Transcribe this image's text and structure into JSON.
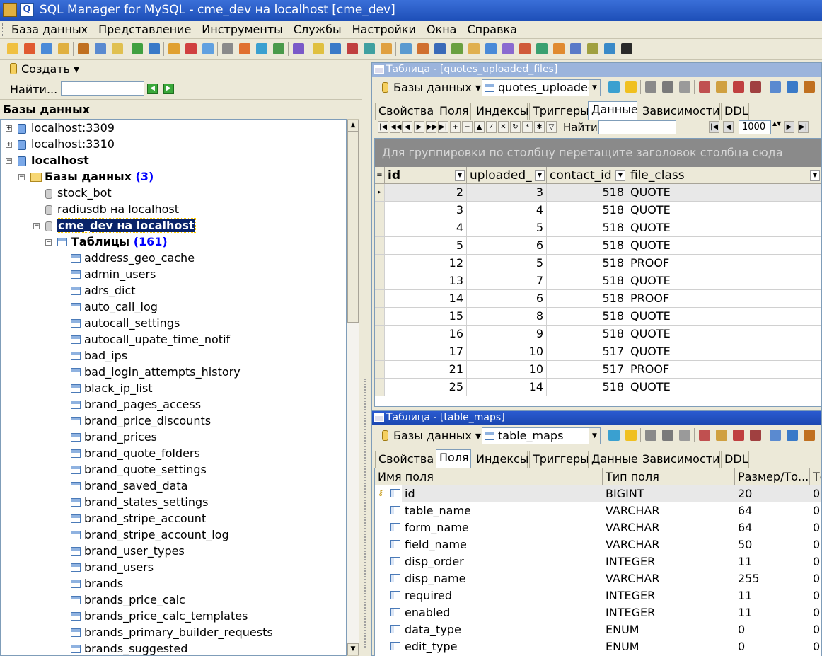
{
  "window": {
    "title": "SQL Manager for MySQL - cme_dev на localhost [cme_dev]"
  },
  "menu": [
    "База данных",
    "Представление",
    "Инструменты",
    "Службы",
    "Настройки",
    "Окна",
    "Справка"
  ],
  "left_panel": {
    "create_label": "Создать",
    "find_label": "Найти...",
    "find_value": "",
    "header": "Базы данных",
    "tree": {
      "servers": [
        "localhost:3309",
        "localhost:3310",
        "localhost"
      ],
      "databases_label": "Базы данных",
      "databases_count": "(3)",
      "databases": [
        "stock_bot",
        "radiusdb на localhost",
        "cme_dev на localhost"
      ],
      "tables_label": "Таблицы",
      "tables_count": "(161)",
      "tables": [
        "address_geo_cache",
        "admin_users",
        "adrs_dict",
        "auto_call_log",
        "autocall_settings",
        "autocall_upate_time_notif",
        "bad_ips",
        "bad_login_attempts_history",
        "black_ip_list",
        "brand_pages_access",
        "brand_price_discounts",
        "brand_prices",
        "brand_quote_folders",
        "brand_quote_settings",
        "brand_saved_data",
        "brand_states_settings",
        "brand_stripe_account",
        "brand_stripe_account_log",
        "brand_user_types",
        "brand_users",
        "brands",
        "brands_price_calc",
        "brands_price_calc_templates",
        "brands_primary_builder_requests",
        "brands_suggested"
      ]
    }
  },
  "window1": {
    "title": "Таблица - [quotes_uploaded_files]",
    "db_button": "Базы данных",
    "table_combo": "quotes_uploaded_files",
    "tabs": [
      "Свойства",
      "Поля",
      "Индексы",
      "Триггеры",
      "Данные",
      "Зависимости",
      "DDL"
    ],
    "active_tab": "Данные",
    "find_label": "Найти:",
    "limit": "1000",
    "group_hint": "Для группировки по столбцу перетащите заголовок столбца сюда",
    "columns": [
      "id",
      "uploaded_",
      "contact_id",
      "file_class"
    ],
    "rows": [
      [
        "2",
        "3",
        "518",
        "QUOTE"
      ],
      [
        "3",
        "4",
        "518",
        "QUOTE"
      ],
      [
        "4",
        "5",
        "518",
        "QUOTE"
      ],
      [
        "5",
        "6",
        "518",
        "QUOTE"
      ],
      [
        "12",
        "5",
        "518",
        "PROOF"
      ],
      [
        "13",
        "7",
        "518",
        "QUOTE"
      ],
      [
        "14",
        "6",
        "518",
        "PROOF"
      ],
      [
        "15",
        "8",
        "518",
        "QUOTE"
      ],
      [
        "16",
        "9",
        "518",
        "QUOTE"
      ],
      [
        "17",
        "10",
        "517",
        "QUOTE"
      ],
      [
        "21",
        "10",
        "517",
        "PROOF"
      ],
      [
        "25",
        "14",
        "518",
        "QUOTE"
      ]
    ]
  },
  "window2": {
    "title": "Таблица - [table_maps]",
    "db_button": "Базы данных",
    "table_combo": "table_maps",
    "tabs": [
      "Свойства",
      "Поля",
      "Индексы",
      "Триггеры",
      "Данные",
      "Зависимости",
      "DDL"
    ],
    "active_tab": "Поля",
    "columns": [
      "Имя поля",
      "Тип поля",
      "Размер/То...",
      "То"
    ],
    "rows": [
      [
        "id",
        "BIGINT",
        "20",
        "0"
      ],
      [
        "table_name",
        "VARCHAR",
        "64",
        "0"
      ],
      [
        "form_name",
        "VARCHAR",
        "64",
        "0"
      ],
      [
        "field_name",
        "VARCHAR",
        "50",
        "0"
      ],
      [
        "disp_order",
        "INTEGER",
        "11",
        "0"
      ],
      [
        "disp_name",
        "VARCHAR",
        "255",
        "0"
      ],
      [
        "required",
        "INTEGER",
        "11",
        "0"
      ],
      [
        "enabled",
        "INTEGER",
        "11",
        "0"
      ],
      [
        "data_type",
        "ENUM",
        "0",
        "0"
      ],
      [
        "edit_type",
        "ENUM",
        "0",
        "0"
      ]
    ]
  }
}
